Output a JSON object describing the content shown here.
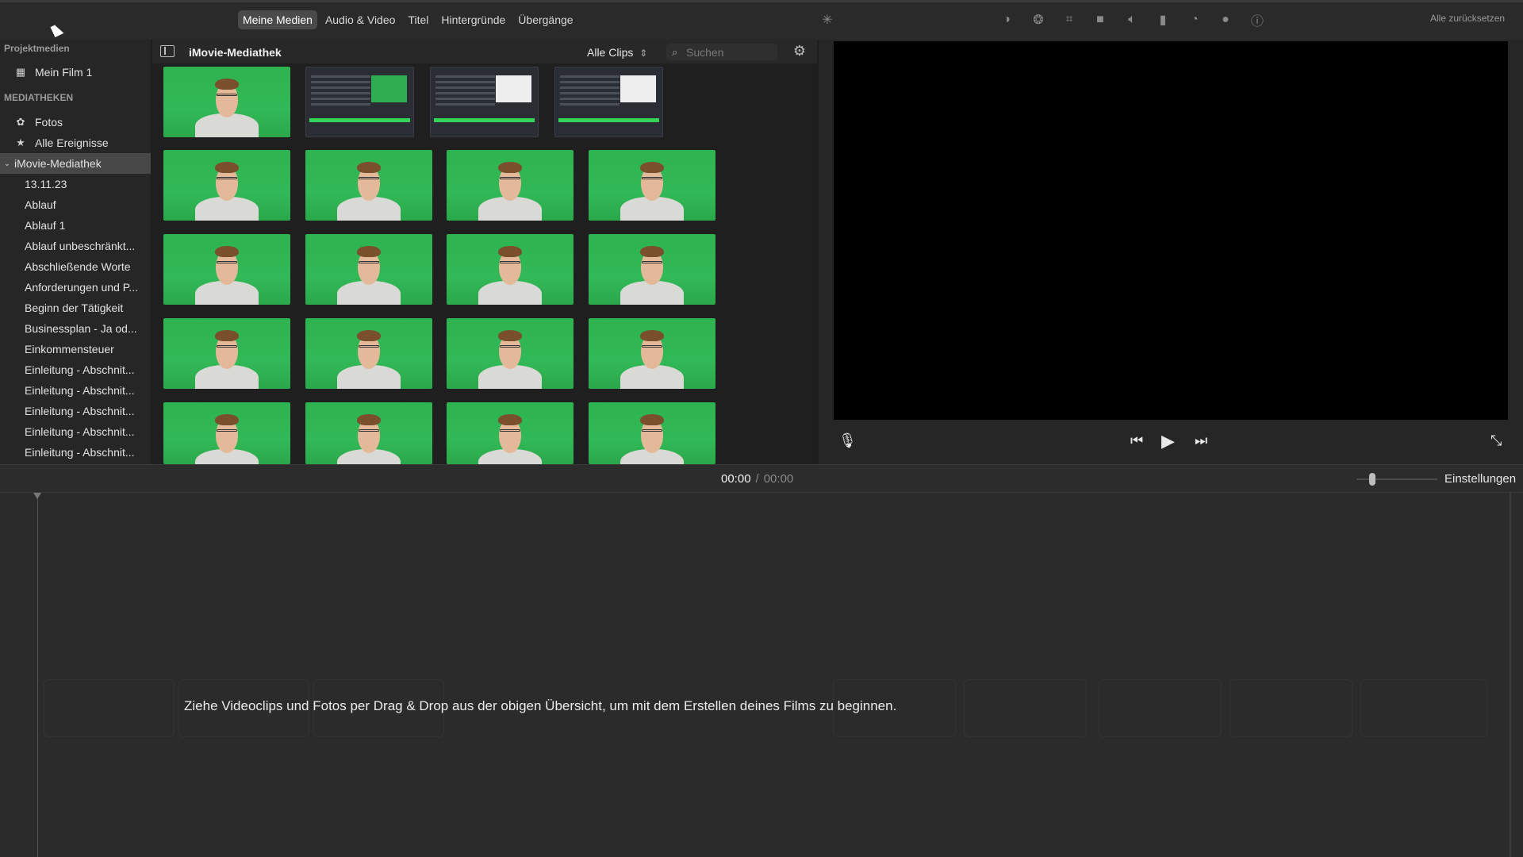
{
  "toolbar": {
    "tabs": [
      {
        "label": "Meine Medien",
        "active": true
      },
      {
        "label": "Audio & Video",
        "active": false
      },
      {
        "label": "Titel",
        "active": false
      },
      {
        "label": "Hintergründe",
        "active": false
      },
      {
        "label": "Übergänge",
        "active": false
      }
    ],
    "tools": [
      "magic-wand-icon",
      "color-balance-icon",
      "color-correction-icon",
      "crop-icon",
      "stabilization-icon",
      "volume-icon",
      "noise-reduction-icon",
      "speed-icon",
      "filter-icon",
      "info-icon"
    ],
    "reset_label": "Alle zurücksetzen"
  },
  "sidebar": {
    "project_header": "Projektmedien",
    "project_item": "Mein Film 1",
    "libraries_header": "MEDIATHEKEN",
    "photos": "Fotos",
    "all_events": "Alle Ereignisse",
    "library": "iMovie-Mediathek",
    "events": [
      "13.11.23",
      "Ablauf",
      "Ablauf 1",
      "Ablauf unbeschränkt...",
      "Abschließende Worte",
      "Anforderungen und P...",
      "Beginn der Tätigkeit",
      "Businessplan - Ja od...",
      "Einkommensteuer",
      "Einleitung - Abschnit...",
      "Einleitung - Abschnit...",
      "Einleitung - Abschnit...",
      "Einleitung - Abschnit...",
      "Einleitung - Abschnit..."
    ]
  },
  "browser": {
    "title": "iMovie-Mediathek",
    "filter": "Alle Clips",
    "search_placeholder": "Suchen"
  },
  "viewer": {
    "current_time": "00:00",
    "separator": "/",
    "total_time": "00:00"
  },
  "timeline": {
    "settings_label": "Einstellungen",
    "drop_hint": "Ziehe Videoclips und Fotos per Drag & Drop aus der obigen Übersicht, um mit dem Erstellen deines Films zu beginnen."
  }
}
